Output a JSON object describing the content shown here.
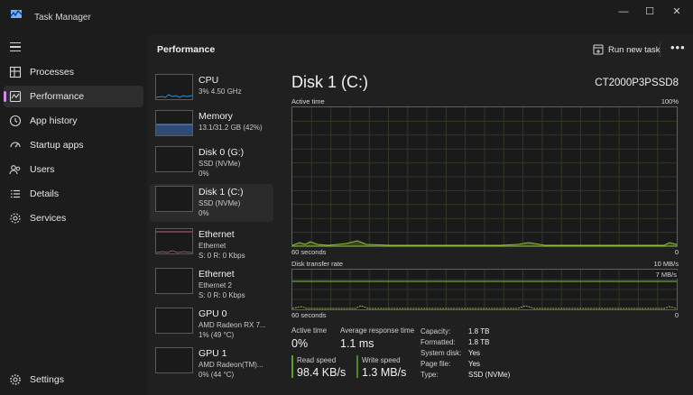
{
  "window": {
    "title": "Task Manager",
    "minimize_glyph": "—",
    "maximize_glyph": "☐",
    "close_glyph": "✕"
  },
  "nav": {
    "items": [
      {
        "label": "Processes",
        "icon": "processes-icon"
      },
      {
        "label": "Performance",
        "icon": "performance-icon",
        "active": true
      },
      {
        "label": "App history",
        "icon": "history-icon"
      },
      {
        "label": "Startup apps",
        "icon": "startup-icon"
      },
      {
        "label": "Users",
        "icon": "users-icon"
      },
      {
        "label": "Details",
        "icon": "details-icon"
      },
      {
        "label": "Services",
        "icon": "services-icon"
      }
    ],
    "settings_label": "Settings"
  },
  "header": {
    "title": "Performance",
    "run_task_label": "Run new task",
    "more_glyph": "•••"
  },
  "devices": [
    {
      "name": "CPU",
      "line1": "3% 4.50 GHz",
      "line2": ""
    },
    {
      "name": "Memory",
      "line1": "13.1/31.2 GB (42%)",
      "line2": ""
    },
    {
      "name": "Disk 0 (G:)",
      "line1": "SSD (NVMe)",
      "line2": "0%"
    },
    {
      "name": "Disk 1 (C:)",
      "line1": "SSD (NVMe)",
      "line2": "0%",
      "active": true
    },
    {
      "name": "Ethernet",
      "line1": "Ethernet",
      "line2": "S: 0 R: 0 Kbps"
    },
    {
      "name": "Ethernet",
      "line1": "Ethernet 2",
      "line2": "S: 0 R: 0 Kbps"
    },
    {
      "name": "GPU 0",
      "line1": "AMD Radeon RX 7...",
      "line2": "1% (49 °C)"
    },
    {
      "name": "GPU 1",
      "line1": "AMD Radeon(TM)...",
      "line2": "0% (44 °C)"
    }
  ],
  "detail": {
    "title": "Disk 1 (C:)",
    "model": "CT2000P3PSSD8",
    "active_time_graph": {
      "label": "Active time",
      "max_label": "100%",
      "time_label": "60 seconds",
      "min_label": "0"
    },
    "transfer_graph": {
      "label": "Disk transfer rate",
      "max_label": "10 MB/s",
      "marker_label": "7 MB/s",
      "time_label": "60 seconds",
      "min_label": "0"
    },
    "stats": {
      "active_time_label": "Active time",
      "active_time_value": "0%",
      "response_label": "Average response time",
      "response_value": "1.1 ms",
      "read_label": "Read speed",
      "read_value": "98.4 KB/s",
      "write_label": "Write speed",
      "write_value": "1.3 MB/s"
    },
    "properties": [
      {
        "key": "Capacity:",
        "value": "1.8 TB"
      },
      {
        "key": "Formatted:",
        "value": "1.8 TB"
      },
      {
        "key": "System disk:",
        "value": "Yes"
      },
      {
        "key": "Page file:",
        "value": "Yes"
      },
      {
        "key": "Type:",
        "value": "SSD (NVMe)"
      }
    ]
  },
  "colors": {
    "accent": "#d08be8",
    "disk_line": "#8fbf3a",
    "cpu_line": "#2f8fd6",
    "memory_fill": "#3a5a88",
    "ethernet_line": "#c06090",
    "read_bar": "#5aa02c",
    "write_bar": "#5aa02c"
  }
}
